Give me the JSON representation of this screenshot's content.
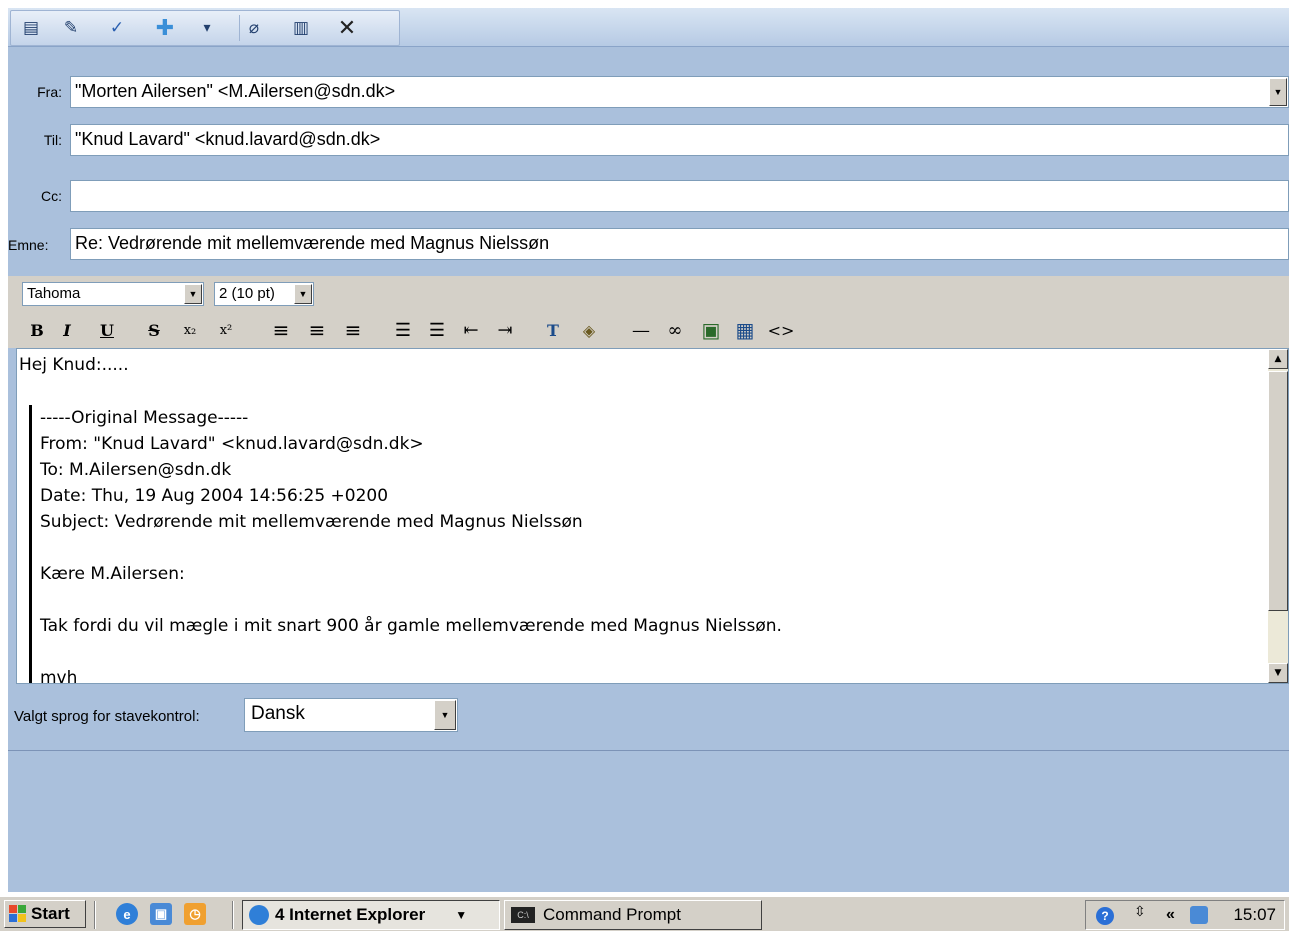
{
  "toolbar": {
    "buttons": [
      {
        "name": "send-icon",
        "glyph": "▤"
      },
      {
        "name": "save-draft-icon",
        "glyph": "✎"
      },
      {
        "name": "spellcheck-icon",
        "glyph": "✓"
      },
      {
        "name": "priority-icon",
        "glyph": "✚"
      },
      {
        "name": "dropdown-arrow-icon",
        "glyph": "▾"
      },
      {
        "name": "attach-icon",
        "glyph": "⌀"
      },
      {
        "name": "address-book-icon",
        "glyph": "▥"
      },
      {
        "name": "close-icon",
        "glyph": "✕"
      }
    ]
  },
  "header": {
    "from_label": "Fra:",
    "from_value": "\"Morten Ailersen\" <M.Ailersen@sdn.dk>",
    "to_label": "Til:",
    "to_value": "\"Knud Lavard\" <knud.lavard@sdn.dk>",
    "cc_label": "Cc:",
    "cc_value": "",
    "subject_label": "Emne:",
    "subject_value": "Re: Vedrørende mit mellemværende med Magnus Nielssøn"
  },
  "editor": {
    "font_family": "Tahoma",
    "font_size": "2 (10 pt)",
    "format_buttons": [
      {
        "name": "bold-button",
        "glyph": "B"
      },
      {
        "name": "italic-button",
        "glyph": "I"
      },
      {
        "name": "underline-button",
        "glyph": "U"
      },
      {
        "name": "strikethrough-button",
        "glyph": "S"
      },
      {
        "name": "subscript-button",
        "glyph": "x₂"
      },
      {
        "name": "superscript-button",
        "glyph": "x²"
      },
      {
        "name": "align-left-button",
        "glyph": "≡"
      },
      {
        "name": "align-center-button",
        "glyph": "≡"
      },
      {
        "name": "align-right-button",
        "glyph": "≡"
      },
      {
        "name": "numbered-list-button",
        "glyph": "☰"
      },
      {
        "name": "bullet-list-button",
        "glyph": "☰"
      },
      {
        "name": "outdent-button",
        "glyph": "⇤"
      },
      {
        "name": "indent-button",
        "glyph": "⇥"
      },
      {
        "name": "text-color-button",
        "glyph": "T"
      },
      {
        "name": "highlight-color-button",
        "glyph": "◈"
      },
      {
        "name": "horizontal-rule-button",
        "glyph": "—"
      },
      {
        "name": "link-button",
        "glyph": "∞"
      },
      {
        "name": "image-button",
        "glyph": "▣"
      },
      {
        "name": "table-button",
        "glyph": "▦"
      },
      {
        "name": "html-source-button",
        "glyph": "<>"
      }
    ],
    "greeting": "Hej Knud:.....",
    "quote": {
      "sep": "-----Original Message-----",
      "from": "From: \"Knud Lavard\" <knud.lavard@sdn.dk>",
      "to": "To: M.Ailersen@sdn.dk",
      "date": "Date: Thu, 19 Aug 2004 14:56:25 +0200",
      "subject": "Subject: Vedrørende mit mellemværende med Magnus Nielssøn",
      "salutation": "Kære M.Ailersen:",
      "body": "Tak fordi du vil mægle i mit snart 900 år gamle mellemværende med Magnus Nielssøn.",
      "signoff": "mvh"
    }
  },
  "spell": {
    "label": "Valgt sprog for stavekontrol:",
    "language": "Dansk"
  },
  "taskbar": {
    "start": "Start",
    "ie_group": "4 Internet Explorer",
    "cmd": "Command Prompt",
    "clock": "15:07"
  }
}
